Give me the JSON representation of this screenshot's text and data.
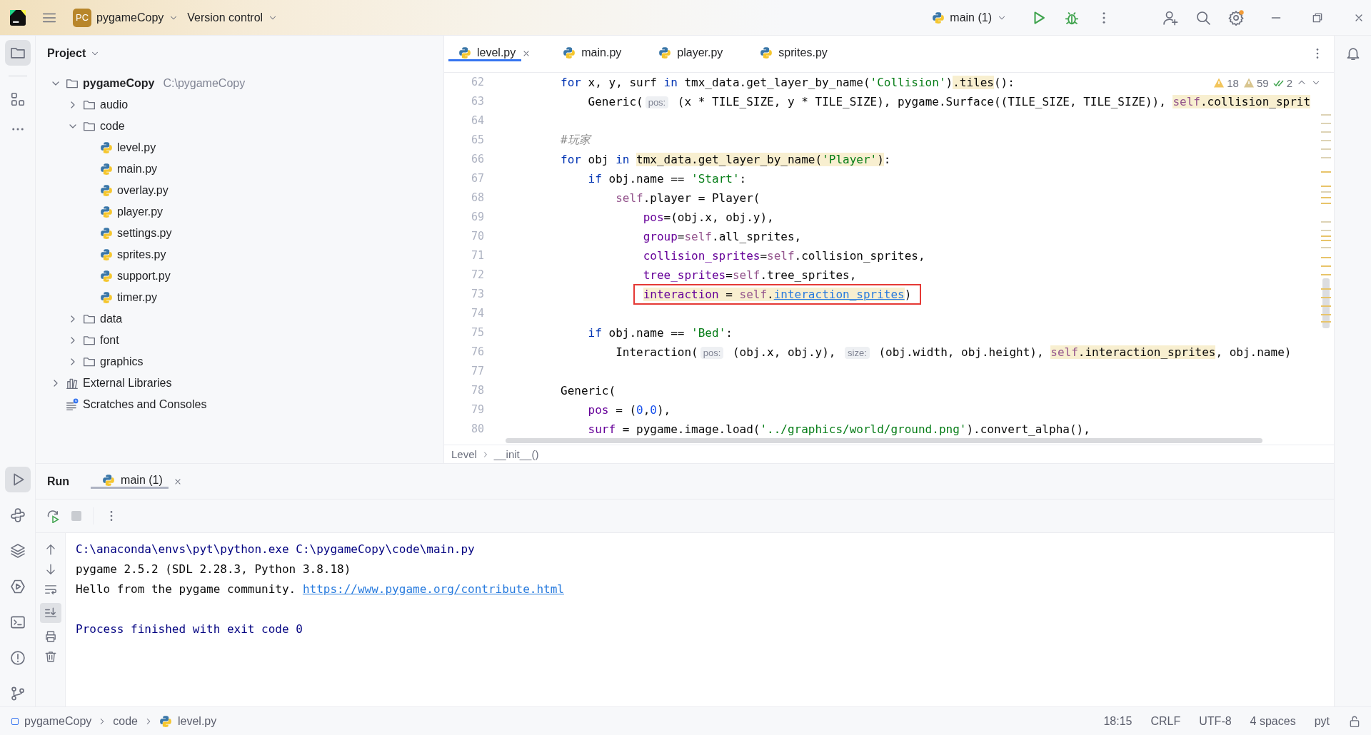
{
  "title_bar": {
    "project_badge": "PC",
    "project": "pygameCopy",
    "vcs": "Version control",
    "run_config": "main (1)"
  },
  "left_stripe": {
    "top": [
      {
        "selected": true
      },
      {
        "selected": false
      }
    ],
    "bottom": [
      {
        "selected": true
      },
      {
        "selected": false
      },
      {
        "selected": false
      },
      {
        "selected": false
      },
      {
        "selected": false
      },
      {
        "selected": false
      },
      {
        "selected": false
      }
    ]
  },
  "project": {
    "title": "Project",
    "tree": [
      {
        "kind": "folder",
        "name": "pygameCopy",
        "path": "C:\\pygameCopy",
        "expanded": true,
        "children": [
          {
            "kind": "folder",
            "name": "audio",
            "expanded": false
          },
          {
            "kind": "folder",
            "name": "code",
            "expanded": true,
            "children": [
              {
                "kind": "file",
                "name": "level.py"
              },
              {
                "kind": "file",
                "name": "main.py"
              },
              {
                "kind": "file",
                "name": "overlay.py"
              },
              {
                "kind": "file",
                "name": "player.py"
              },
              {
                "kind": "file",
                "name": "settings.py"
              },
              {
                "kind": "file",
                "name": "sprites.py"
              },
              {
                "kind": "file",
                "name": "support.py"
              },
              {
                "kind": "file",
                "name": "timer.py"
              }
            ]
          },
          {
            "kind": "folder",
            "name": "data",
            "expanded": false
          },
          {
            "kind": "folder",
            "name": "font",
            "expanded": false
          },
          {
            "kind": "folder",
            "name": "graphics",
            "expanded": false
          }
        ]
      },
      {
        "kind": "libraries",
        "name": "External Libraries",
        "expanded": false
      },
      {
        "kind": "scratches",
        "name": "Scratches and Consoles"
      }
    ]
  },
  "editor": {
    "tabs": [
      {
        "label": "level.py",
        "selected": true,
        "closable": true
      },
      {
        "label": "main.py",
        "selected": false,
        "closable": false
      },
      {
        "label": "player.py",
        "selected": false,
        "closable": false
      },
      {
        "label": "sprites.py",
        "selected": false,
        "closable": false
      }
    ],
    "inspections": {
      "warnings": "18",
      "weak_warnings": "59",
      "passed": "2"
    },
    "lines": [
      {
        "number": "62",
        "segments": [
          {
            "kind": "kw",
            "text": "        for"
          },
          {
            "kind": "plain",
            "text": " x, y, surf "
          },
          {
            "kind": "kw",
            "text": "in"
          },
          {
            "kind": "plain",
            "text": " tmx_data.get_layer_by_name("
          },
          {
            "kind": "str",
            "text": "'Collision'"
          },
          {
            "kind": "plain",
            "text": ")"
          },
          {
            "kind": "mark",
            "parts": [
              {
                "kind": "plain",
                "text": ".tiles"
              }
            ]
          },
          {
            "kind": "plain",
            "text": "():"
          }
        ]
      },
      {
        "number": "63",
        "segments": [
          {
            "kind": "plain",
            "text": "            Generic("
          },
          {
            "kind": "hint",
            "text": "pos:"
          },
          {
            "kind": "plain",
            "text": " (x * TILE_SIZE, y * TILE_SIZE), pygame.Surface((TILE_SIZE, TILE_SIZE)), "
          },
          {
            "kind": "mark",
            "parts": [
              {
                "kind": "self",
                "text": "self"
              },
              {
                "kind": "plain",
                "text": ".collision_sprit"
              }
            ]
          }
        ]
      },
      {
        "number": "64"
      },
      {
        "number": "65",
        "segments": [
          {
            "kind": "comment",
            "text": "        #玩家"
          }
        ]
      },
      {
        "number": "66",
        "segments": [
          {
            "kind": "kw",
            "text": "        for"
          },
          {
            "kind": "plain",
            "text": " obj "
          },
          {
            "kind": "kw",
            "text": "in "
          },
          {
            "kind": "mark",
            "parts": [
              {
                "kind": "plain",
                "text": "tmx_data.get_layer_by_name("
              },
              {
                "kind": "str",
                "text": "'Player'"
              },
              {
                "kind": "plain",
                "text": ")"
              }
            ]
          },
          {
            "kind": "plain",
            "text": ":"
          }
        ]
      },
      {
        "number": "67",
        "segments": [
          {
            "kind": "kw",
            "text": "            if"
          },
          {
            "kind": "plain",
            "text": " obj.name == "
          },
          {
            "kind": "str",
            "text": "'Start'"
          },
          {
            "kind": "plain",
            "text": ":"
          }
        ]
      },
      {
        "number": "68",
        "segments": [
          {
            "kind": "self",
            "text": "                self"
          },
          {
            "kind": "plain",
            "text": ".player = Player("
          }
        ]
      },
      {
        "number": "69",
        "segments": [
          {
            "kind": "param",
            "text": "                    pos"
          },
          {
            "kind": "plain",
            "text": "=(obj.x, obj.y),"
          }
        ]
      },
      {
        "number": "70",
        "segments": [
          {
            "kind": "param",
            "text": "                    group"
          },
          {
            "kind": "plain",
            "text": "="
          },
          {
            "kind": "self",
            "text": "self"
          },
          {
            "kind": "plain",
            "text": ".all_sprites,"
          }
        ]
      },
      {
        "number": "71",
        "segments": [
          {
            "kind": "param",
            "text": "                    collision_sprites"
          },
          {
            "kind": "plain",
            "text": "="
          },
          {
            "kind": "self",
            "text": "self"
          },
          {
            "kind": "plain",
            "text": ".collision_sprites,"
          }
        ]
      },
      {
        "number": "72",
        "segments": [
          {
            "kind": "param",
            "text": "                    tree_sprites"
          },
          {
            "kind": "plain",
            "text": "="
          },
          {
            "kind": "self",
            "text": "self"
          },
          {
            "kind": "plain",
            "text": ".tree_sprites,"
          }
        ]
      },
      {
        "number": "73",
        "segments": [
          {
            "kind": "box",
            "parts": [
              {
                "kind": "mark",
                "parts": [
                  {
                    "kind": "param",
                    "text": "                    interaction"
                  },
                  {
                    "kind": "plain",
                    "text": " = "
                  },
                  {
                    "kind": "self",
                    "text": "self"
                  },
                  {
                    "kind": "plain",
                    "text": "."
                  },
                  {
                    "kind": "link",
                    "text": "interaction_sprites"
                  }
                ]
              },
              {
                "kind": "plain",
                "text": ")"
              }
            ]
          }
        ]
      },
      {
        "number": "74"
      },
      {
        "number": "75",
        "segments": [
          {
            "kind": "kw",
            "text": "            if"
          },
          {
            "kind": "plain",
            "text": " obj.name == "
          },
          {
            "kind": "str",
            "text": "'Bed'"
          },
          {
            "kind": "plain",
            "text": ":"
          }
        ]
      },
      {
        "number": "76",
        "segments": [
          {
            "kind": "plain",
            "text": "                Interaction("
          },
          {
            "kind": "hint",
            "text": "pos:"
          },
          {
            "kind": "plain",
            "text": " (obj.x, obj.y), "
          },
          {
            "kind": "hint",
            "text": "size:"
          },
          {
            "kind": "plain",
            "text": " (obj.width, obj.height), "
          },
          {
            "kind": "mark",
            "parts": [
              {
                "kind": "self",
                "text": "self"
              },
              {
                "kind": "plain",
                "text": ".interaction_sprites"
              }
            ]
          },
          {
            "kind": "plain",
            "text": ", obj.name)"
          }
        ]
      },
      {
        "number": "77"
      },
      {
        "number": "78",
        "segments": [
          {
            "kind": "plain",
            "text": "        Generic("
          }
        ]
      },
      {
        "number": "79",
        "segments": [
          {
            "kind": "param",
            "text": "            pos"
          },
          {
            "kind": "plain",
            "text": " = ("
          },
          {
            "kind": "num",
            "text": "0"
          },
          {
            "kind": "plain",
            "text": ","
          },
          {
            "kind": "num",
            "text": "0"
          },
          {
            "kind": "plain",
            "text": "),"
          }
        ]
      },
      {
        "number": "80",
        "segments": [
          {
            "kind": "param",
            "text": "            surf"
          },
          {
            "kind": "plain",
            "text": " = pygame.image.load("
          },
          {
            "kind": "str",
            "text": "'../graphics/world/ground.png'"
          },
          {
            "kind": "plain",
            "text": ").convert_alpha(),"
          }
        ]
      }
    ],
    "breadcrumb": [
      "Level",
      "__init__()"
    ]
  },
  "run": {
    "title": "Run",
    "tabs": [
      {
        "label": "main (1)",
        "selected": true
      }
    ],
    "stop_disabled": true,
    "scroll_to_end_on": true,
    "console": [
      {
        "kind": "command",
        "text": "C:\\anaconda\\envs\\pyt\\python.exe C:\\pygameCopy\\code\\main.py"
      },
      {
        "kind": "output",
        "text": "pygame 2.5.2 (SDL 2.28.3, Python 3.8.18)"
      },
      {
        "kind": "output",
        "text": "Hello from the pygame community. ",
        "link": "https://www.pygame.org/contribute.html"
      },
      {
        "kind": "exit",
        "text": "Process finished with exit code 0"
      }
    ]
  },
  "status_bar": {
    "path": [
      {
        "kind": "project",
        "text": "pygameCopy"
      },
      {
        "kind": "folder",
        "text": "code"
      },
      {
        "kind": "file",
        "text": "level.py"
      }
    ],
    "items": [
      "18:15",
      "CRLF",
      "UTF-8",
      "4 spaces",
      "pyt"
    ]
  }
}
